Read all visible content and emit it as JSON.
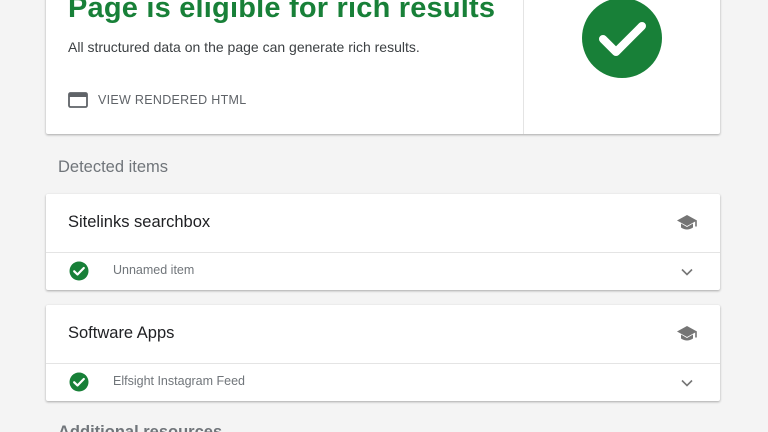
{
  "summary": {
    "status_title": "Page is eligible for rich results",
    "status_description": "All structured data on the page can generate rich results.",
    "view_html_label": "VIEW RENDERED HTML",
    "status_icon": "check-circle-icon",
    "status_color": "#188038"
  },
  "detected": {
    "heading": "Detected items",
    "items": [
      {
        "title": "Sitelinks searchbox",
        "row_label": "Unnamed item",
        "row_status": "valid"
      },
      {
        "title": "Software Apps",
        "row_label": "Elfsight Instagram Feed",
        "row_status": "valid"
      }
    ]
  },
  "footer": {
    "heading": "Additional resources"
  },
  "colors": {
    "accent_green": "#188038",
    "icon_grey": "#757575",
    "background": "#f4f4f4"
  }
}
